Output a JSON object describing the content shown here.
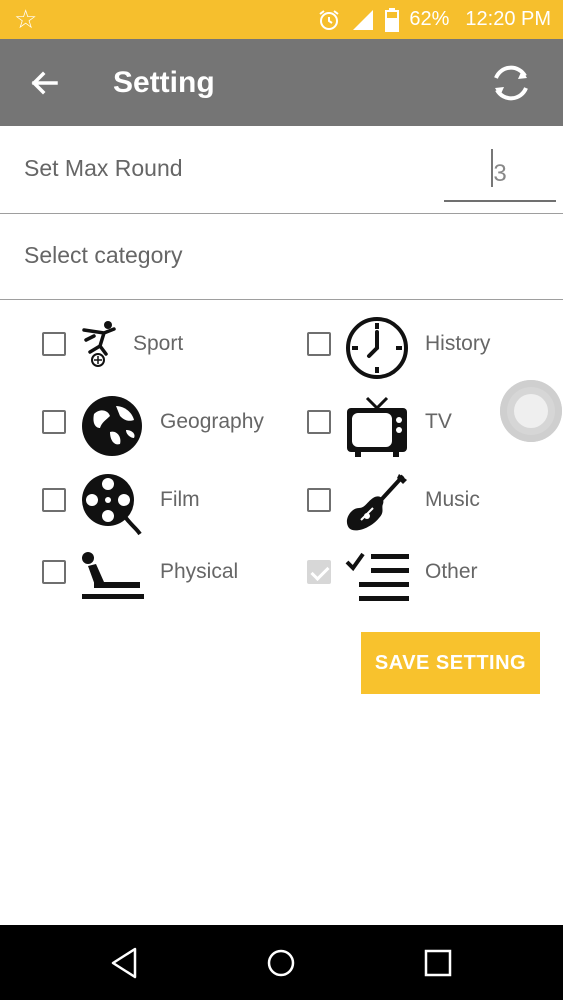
{
  "status_bar": {
    "battery": "62%",
    "time": "12:20 PM",
    "icons": [
      "star-icon",
      "alarm-icon",
      "signal-icon",
      "battery-icon"
    ]
  },
  "app_bar": {
    "title": "Setting",
    "back_icon": "arrow-back-icon",
    "action_icon": "refresh-icon"
  },
  "max_round": {
    "label": "Set Max Round",
    "value": "3"
  },
  "category_section": {
    "label": "Select category"
  },
  "categories": [
    {
      "name": "Sport",
      "checked": false,
      "icon": "soccer-player-icon"
    },
    {
      "name": "History",
      "checked": false,
      "icon": "clock-icon"
    },
    {
      "name": "Geography",
      "checked": false,
      "icon": "globe-icon"
    },
    {
      "name": "TV",
      "checked": false,
      "icon": "tv-icon"
    },
    {
      "name": "Film",
      "checked": false,
      "icon": "film-reel-icon"
    },
    {
      "name": "Music",
      "checked": false,
      "icon": "guitar-icon"
    },
    {
      "name": "Physical",
      "checked": false,
      "icon": "pushup-icon"
    },
    {
      "name": "Other",
      "checked": true,
      "icon": "checklist-icon"
    }
  ],
  "save_button": {
    "label": "SAVE SETTING"
  },
  "colors": {
    "status_bar": "#f6bf2d",
    "app_bar": "#757575",
    "accent": "#f8c22d"
  },
  "nav_bar": {
    "icons": [
      "back-triangle-icon",
      "home-circle-icon",
      "recents-square-icon"
    ]
  }
}
